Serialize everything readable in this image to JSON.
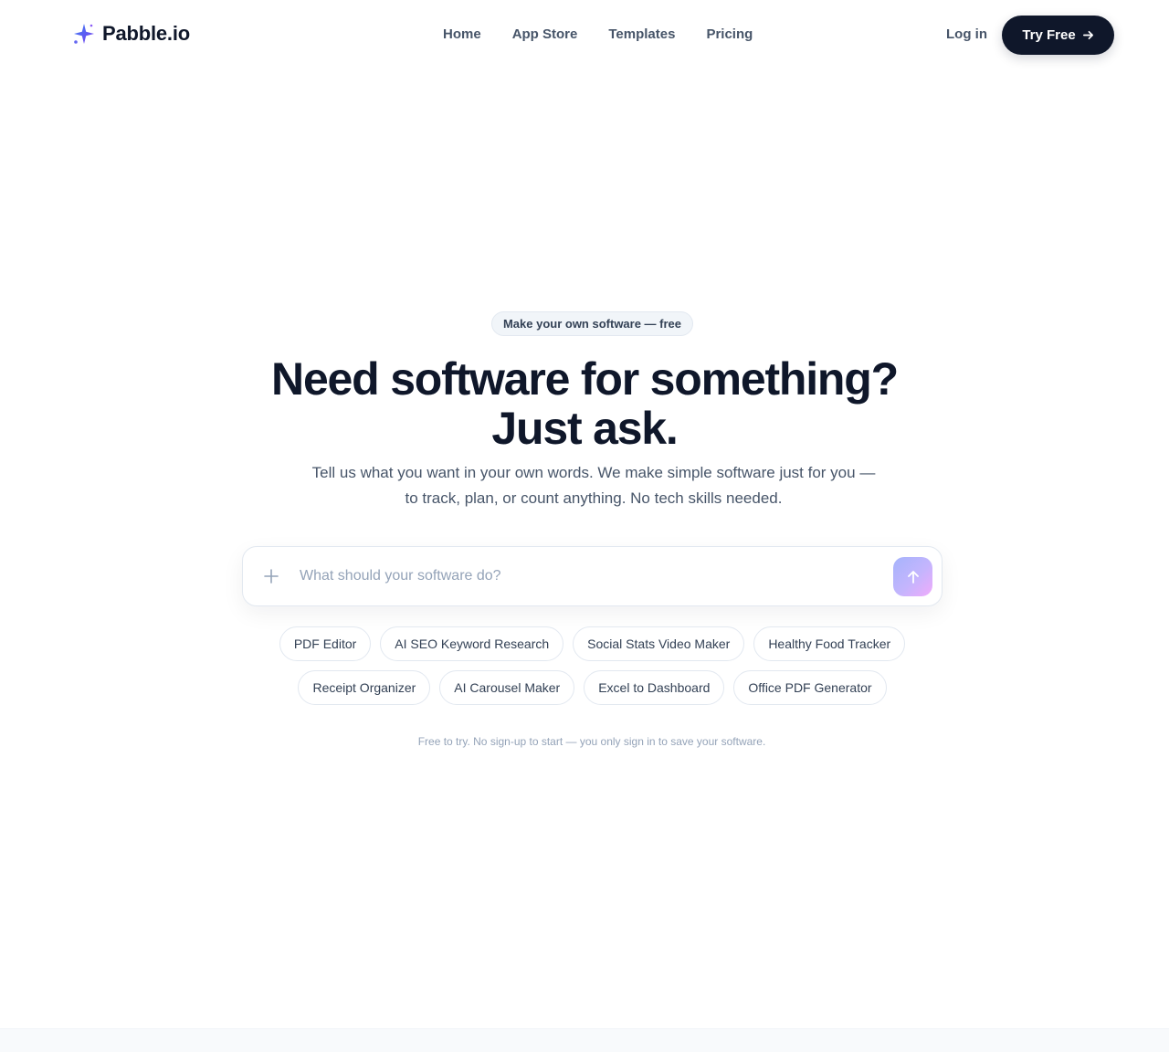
{
  "brand": {
    "name": "Pabble.io",
    "accent": "#6366f1"
  },
  "nav": {
    "items": [
      {
        "label": "Home"
      },
      {
        "label": "App Store"
      },
      {
        "label": "Templates"
      },
      {
        "label": "Pricing"
      }
    ],
    "login_label": "Log in",
    "cta_label": "Try Free"
  },
  "hero": {
    "badge": "Make your own software — free",
    "headline_line1": "Need software for something?",
    "headline_line2": "Just ask.",
    "subtext": "Tell us what you want in your own words. We make simple software just for you — to track, plan, or count anything. No tech skills needed."
  },
  "prompt": {
    "value": "",
    "placeholder": "What should your software do?"
  },
  "suggestions": {
    "row1": [
      "PDF Editor",
      "AI SEO Keyword Research",
      "Social Stats Video Maker",
      "Healthy Food Tracker"
    ],
    "row2": [
      "Receipt Organizer",
      "AI Carousel Maker",
      "Excel to Dashboard",
      "Office PDF Generator"
    ]
  },
  "footnote": "Free to try. No sign-up to start — you only sign in to save your software."
}
